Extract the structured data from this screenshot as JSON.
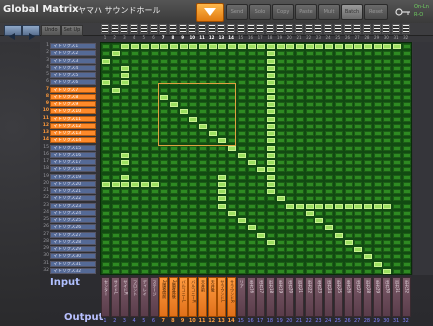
{
  "header": {
    "title": "Global Matrix",
    "subtitle": "ヤマハ サウンドホール",
    "buttons": [
      "Send",
      "Solo",
      "Copy",
      "Paste",
      "Mult",
      "Batch",
      "Reset"
    ],
    "onoff": [
      "On-Ln",
      "R-O",
      "Off"
    ]
  },
  "toolbar": {
    "buttons": [
      "Undo",
      "Set Up"
    ],
    "column_numbers": [
      "1",
      "2",
      "3",
      "4",
      "5",
      "6",
      "7",
      "8",
      "9",
      "10",
      "11",
      "12",
      "13",
      "14",
      "15",
      "16",
      "17",
      "18",
      "19",
      "20",
      "21",
      "22",
      "23",
      "24",
      "25",
      "26",
      "27",
      "28",
      "29",
      "30",
      "31",
      "32"
    ]
  },
  "inputs": {
    "label": "Input",
    "rows": [
      {
        "num": "1",
        "name": "マトリクス1",
        "selected": false
      },
      {
        "num": "2",
        "name": "マトリクス2",
        "selected": false
      },
      {
        "num": "3",
        "name": "マトリクス3",
        "selected": false
      },
      {
        "num": "4",
        "name": "マトリクス4",
        "selected": false
      },
      {
        "num": "5",
        "name": "マトリクス5",
        "selected": false
      },
      {
        "num": "6",
        "name": "マトリクス6",
        "selected": false
      },
      {
        "num": "7",
        "name": "マトリクス7",
        "selected": true
      },
      {
        "num": "8",
        "name": "マトリクス8",
        "selected": true
      },
      {
        "num": "9",
        "name": "マトリクス9",
        "selected": true
      },
      {
        "num": "10",
        "name": "マトリクス10",
        "selected": true
      },
      {
        "num": "11",
        "name": "マトリクス11",
        "selected": true
      },
      {
        "num": "12",
        "name": "マトリクス12",
        "selected": true
      },
      {
        "num": "13",
        "name": "マトリクス13",
        "selected": true
      },
      {
        "num": "14",
        "name": "マトリクス14",
        "selected": true
      },
      {
        "num": "15",
        "name": "マトリクス15",
        "selected": false
      },
      {
        "num": "16",
        "name": "マトリクス16",
        "selected": false
      },
      {
        "num": "17",
        "name": "マトリクス17",
        "selected": false
      },
      {
        "num": "18",
        "name": "マトリクス18",
        "selected": false
      },
      {
        "num": "19",
        "name": "マトリクス19",
        "selected": false
      },
      {
        "num": "20",
        "name": "マトリクス20",
        "selected": false
      },
      {
        "num": "21",
        "name": "マトリクス21",
        "selected": false
      },
      {
        "num": "22",
        "name": "マトリクス22",
        "selected": false
      },
      {
        "num": "23",
        "name": "マトリクス23",
        "selected": false
      },
      {
        "num": "24",
        "name": "マトリクス24",
        "selected": false
      },
      {
        "num": "25",
        "name": "マトリクス25",
        "selected": false
      },
      {
        "num": "26",
        "name": "マトリクス26",
        "selected": false
      },
      {
        "num": "27",
        "name": "マトリクス27",
        "selected": false
      },
      {
        "num": "28",
        "name": "マトリクス28",
        "selected": false
      },
      {
        "num": "29",
        "name": "マトリクス29",
        "selected": false
      },
      {
        "num": "30",
        "name": "マトリクス30",
        "selected": false
      },
      {
        "num": "31",
        "name": "マトリクス31",
        "selected": false
      },
      {
        "num": "32",
        "name": "マトリクス32",
        "selected": false
      }
    ]
  },
  "outputs": {
    "label": "Output",
    "columns": [
      {
        "num": "1",
        "name": "センター",
        "selected": false
      },
      {
        "num": "2",
        "name": "サイドL",
        "selected": false
      },
      {
        "num": "3",
        "name": "サイドR",
        "selected": false
      },
      {
        "num": "4",
        "name": "フロント",
        "selected": false
      },
      {
        "num": "5",
        "name": "ディレイ",
        "selected": false
      },
      {
        "num": "6",
        "name": "ステージ",
        "selected": false
      },
      {
        "num": "7",
        "name": "2階客席前",
        "selected": true
      },
      {
        "num": "8",
        "name": "2階客席後",
        "selected": true
      },
      {
        "num": "9",
        "name": "バルコニーL",
        "selected": true
      },
      {
        "num": "10",
        "name": "バルコニーR",
        "selected": true
      },
      {
        "num": "11",
        "name": "天井前",
        "selected": true
      },
      {
        "num": "12",
        "name": "天井後",
        "selected": true
      },
      {
        "num": "13",
        "name": "サラウンドL",
        "selected": true
      },
      {
        "num": "14",
        "name": "サラウンドR",
        "selected": true
      },
      {
        "num": "15",
        "name": "リア",
        "selected": false
      },
      {
        "num": "16",
        "name": "出力16",
        "selected": false
      },
      {
        "num": "17",
        "name": "出力17",
        "selected": false
      },
      {
        "num": "18",
        "name": "出力18",
        "selected": false
      },
      {
        "num": "19",
        "name": "出力19",
        "selected": false
      },
      {
        "num": "20",
        "name": "出力20",
        "selected": false
      },
      {
        "num": "21",
        "name": "出力21",
        "selected": false
      },
      {
        "num": "22",
        "name": "出力22",
        "selected": false
      },
      {
        "num": "23",
        "name": "出力23",
        "selected": false
      },
      {
        "num": "24",
        "name": "出力24",
        "selected": false
      },
      {
        "num": "25",
        "name": "出力25",
        "selected": false
      },
      {
        "num": "26",
        "name": "出力26",
        "selected": false
      },
      {
        "num": "27",
        "name": "出力27",
        "selected": false
      },
      {
        "num": "28",
        "name": "出力28",
        "selected": false
      },
      {
        "num": "29",
        "name": "出力29",
        "selected": false
      },
      {
        "num": "30",
        "name": "出力30",
        "selected": false
      },
      {
        "num": "31",
        "name": "出力31",
        "selected": false
      },
      {
        "num": "32",
        "name": "出力32",
        "selected": false
      }
    ]
  },
  "matrix": {
    "active_cells": [
      [
        1,
        3
      ],
      [
        1,
        4
      ],
      [
        1,
        5
      ],
      [
        1,
        6
      ],
      [
        1,
        7
      ],
      [
        1,
        8
      ],
      [
        1,
        9
      ],
      [
        1,
        10
      ],
      [
        1,
        11
      ],
      [
        1,
        12
      ],
      [
        1,
        13
      ],
      [
        1,
        14
      ],
      [
        1,
        15
      ],
      [
        1,
        16
      ],
      [
        1,
        17
      ],
      [
        1,
        18
      ],
      [
        1,
        19
      ],
      [
        1,
        20
      ],
      [
        1,
        21
      ],
      [
        1,
        22
      ],
      [
        1,
        23
      ],
      [
        1,
        24
      ],
      [
        1,
        25
      ],
      [
        1,
        26
      ],
      [
        1,
        27
      ],
      [
        1,
        28
      ],
      [
        1,
        29
      ],
      [
        1,
        30
      ],
      [
        1,
        31
      ],
      [
        2,
        2
      ],
      [
        2,
        18
      ],
      [
        3,
        1
      ],
      [
        3,
        18
      ],
      [
        4,
        3
      ],
      [
        4,
        18
      ],
      [
        5,
        3
      ],
      [
        5,
        18
      ],
      [
        6,
        1
      ],
      [
        6,
        3
      ],
      [
        6,
        18
      ],
      [
        7,
        2
      ],
      [
        7,
        18
      ],
      [
        8,
        7
      ],
      [
        8,
        18
      ],
      [
        9,
        8
      ],
      [
        9,
        18
      ],
      [
        10,
        9
      ],
      [
        10,
        18
      ],
      [
        11,
        10
      ],
      [
        11,
        18
      ],
      [
        12,
        11
      ],
      [
        12,
        18
      ],
      [
        13,
        12
      ],
      [
        13,
        18
      ],
      [
        14,
        13
      ],
      [
        14,
        18
      ],
      [
        15,
        14
      ],
      [
        15,
        18
      ],
      [
        16,
        3
      ],
      [
        16,
        15
      ],
      [
        16,
        18
      ],
      [
        17,
        3
      ],
      [
        17,
        16
      ],
      [
        17,
        18
      ],
      [
        18,
        17
      ],
      [
        18,
        18
      ],
      [
        19,
        3
      ],
      [
        19,
        13
      ],
      [
        19,
        18
      ],
      [
        20,
        1
      ],
      [
        20,
        2
      ],
      [
        20,
        3
      ],
      [
        20,
        4
      ],
      [
        20,
        5
      ],
      [
        20,
        6
      ],
      [
        20,
        13
      ],
      [
        20,
        18
      ],
      [
        21,
        13
      ],
      [
        21,
        18
      ],
      [
        22,
        13
      ],
      [
        22,
        19
      ],
      [
        23,
        13
      ],
      [
        23,
        20
      ],
      [
        23,
        21
      ],
      [
        23,
        22
      ],
      [
        23,
        23
      ],
      [
        23,
        24
      ],
      [
        23,
        25
      ],
      [
        23,
        26
      ],
      [
        23,
        27
      ],
      [
        23,
        28
      ],
      [
        23,
        29
      ],
      [
        23,
        30
      ],
      [
        24,
        14
      ],
      [
        24,
        22
      ],
      [
        25,
        15
      ],
      [
        25,
        23
      ],
      [
        26,
        16
      ],
      [
        26,
        24
      ],
      [
        27,
        17
      ],
      [
        27,
        25
      ],
      [
        28,
        18
      ],
      [
        28,
        26
      ],
      [
        29,
        27
      ],
      [
        30,
        28
      ],
      [
        31,
        29
      ],
      [
        32,
        30
      ]
    ],
    "colors": {
      "on": "#9ce060",
      "off": "#2e8a22",
      "selected": "#ff8a2a"
    }
  }
}
